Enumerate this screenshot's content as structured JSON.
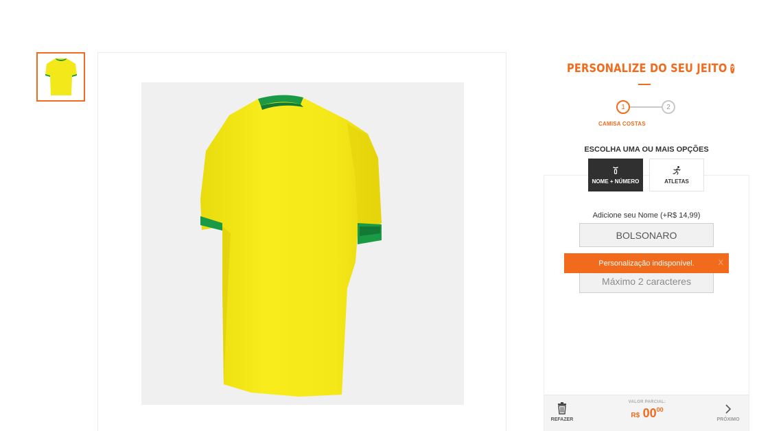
{
  "gallery": {
    "thumbnail_alt": "Camisa costas"
  },
  "personalize": {
    "title": "PERSONALIZE DO SEU JEITO",
    "help_icon": "?",
    "steps": [
      {
        "number": "1",
        "label": "CAMISA COSTAS"
      },
      {
        "number": "2"
      }
    ],
    "choose_label": "ESCOLHA UMA OU MAIS OPÇÕES",
    "options": [
      {
        "icon": "shirt-number-icon",
        "label": "NOME + NÚMERO"
      },
      {
        "icon": "runner-icon",
        "label": "ATLETAS"
      }
    ],
    "name_label": "Adicione seu Nome",
    "name_price": "(+R$ 14,99)",
    "name_value": "BOLSONARO",
    "number_placeholder": "Máximo 2 caracteres",
    "toast_message": "Personalização indisponível.",
    "toast_close": "X"
  },
  "footer": {
    "redo_label": "REFAZER",
    "total_label": "VALOR PARCIAL:",
    "currency": "R$",
    "total_integer": "00",
    "total_decimal": "00",
    "next_label": "PRÓXIMO"
  },
  "colors": {
    "accent": "#f26a1b",
    "active_option": "#303030",
    "jersey_yellow": "#f7ea19",
    "jersey_green": "#19a34a"
  }
}
